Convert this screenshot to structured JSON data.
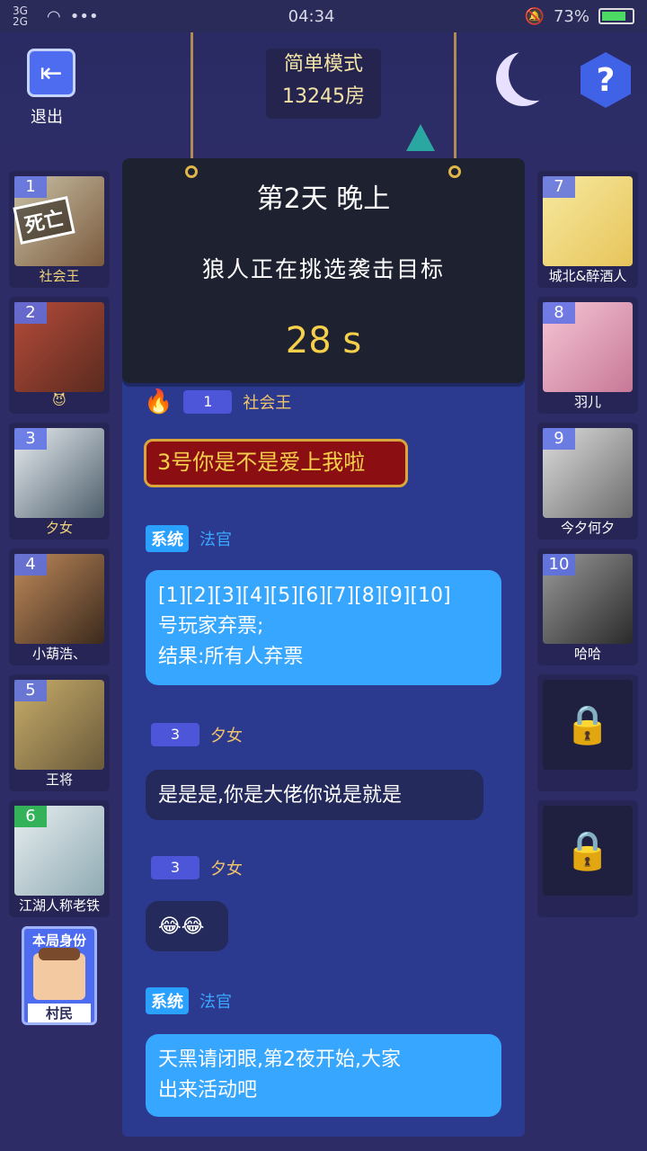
{
  "status": {
    "signal": "3G 2G",
    "dots": "•••",
    "time": "04:34",
    "battery": "73%",
    "battery_level": 0.73
  },
  "header": {
    "exit_label": "退出",
    "mode": "简单模式",
    "room": "13245房",
    "help_symbol": "?"
  },
  "left_seats": [
    {
      "num": "1",
      "name": "社会王",
      "dead_stamp": "死亡"
    },
    {
      "num": "2",
      "name": "😈"
    },
    {
      "num": "3",
      "name": "夕女"
    },
    {
      "num": "4",
      "name": "小葫浩、"
    },
    {
      "num": "5",
      "name": "王将"
    },
    {
      "num": "6",
      "name": "江湖人称老铁"
    }
  ],
  "right_seats": [
    {
      "num": "7",
      "name": "城北&醉酒人"
    },
    {
      "num": "8",
      "name": "羽儿"
    },
    {
      "num": "9",
      "name": "今夕何夕"
    },
    {
      "num": "10",
      "name": "哈哈"
    },
    {
      "locked": true
    },
    {
      "locked": true
    }
  ],
  "role_card": {
    "title": "本局身份",
    "role": "村民"
  },
  "night": {
    "title": "第2天  晚上",
    "subtitle": "狼人正在挑选袭击目标",
    "timer": "28  s"
  },
  "messages": [
    {
      "type": "player",
      "num": "1",
      "name": "社会王",
      "text": "3号你是不是爱上我啦",
      "style": "red"
    },
    {
      "type": "system",
      "tag": "系统",
      "name": "法官",
      "text_lines": [
        "[1][2][3][4][5][6][7][8][9][10]",
        "号玩家弃票;",
        "结果:所有人弃票"
      ]
    },
    {
      "type": "player",
      "num": "3",
      "name": "夕女",
      "text": "是是是,你是大佬你说是就是"
    },
    {
      "type": "player",
      "num": "3",
      "name": "夕女",
      "text": "😂😂"
    },
    {
      "type": "system",
      "tag": "系统",
      "name": "法官",
      "text_lines": [
        "天黑请闭眼,第2夜开始,大家",
        "出来活动吧"
      ]
    }
  ]
}
